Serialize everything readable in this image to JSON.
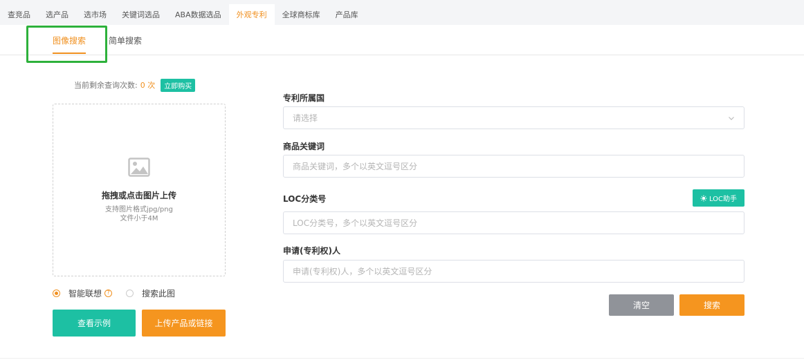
{
  "top_nav": {
    "tabs": [
      {
        "label": "查竞品",
        "active": false
      },
      {
        "label": "选产品",
        "active": false
      },
      {
        "label": "选市场",
        "active": false
      },
      {
        "label": "关键词选品",
        "active": false
      },
      {
        "label": "ABA数据选品",
        "active": false
      },
      {
        "label": "外观专利",
        "active": true
      },
      {
        "label": "全球商标库",
        "active": false
      },
      {
        "label": "产品库",
        "active": false
      }
    ]
  },
  "sub_tabs": {
    "image_search": "图像搜索",
    "simple_search": "简单搜索"
  },
  "quota": {
    "label": "当前剩余查询次数:",
    "count": "0 次",
    "buy_label": "立即购买"
  },
  "upload": {
    "icon": "image-icon",
    "title": "拖拽或点击图片上传",
    "hint_format": "支持图片格式jpg/png",
    "hint_size": "文件小于4M"
  },
  "mode_options": {
    "smart": "智能联想",
    "search_this": "搜索此图",
    "selected": "智能联想"
  },
  "buttons": {
    "example": "查看示例",
    "upload_link": "上传产品或链接",
    "clear": "清空",
    "search": "搜索",
    "loc_helper": "LOC助手"
  },
  "form": {
    "country": {
      "label": "专利所属国",
      "placeholder": "请选择"
    },
    "keyword": {
      "label": "商品关键词",
      "placeholder": "商品关键词，多个以英文逗号区分"
    },
    "loc": {
      "label": "LOC分类号",
      "placeholder": "LOC分类号，多个以英文逗号区分"
    },
    "applicant": {
      "label": "申请(专利权)人",
      "placeholder": "申请(专利权)人，多个以英文逗号区分"
    }
  },
  "colors": {
    "accent_orange": "#f0901f",
    "teal": "#1dc0a3",
    "gray_button": "#909399",
    "highlight_green": "#2db13b"
  }
}
